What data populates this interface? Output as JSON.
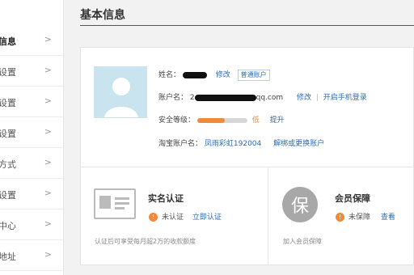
{
  "sidebar": {
    "items": [
      {
        "label": "",
        "active": false
      },
      {
        "label": "信息",
        "active": true
      },
      {
        "label": "设置",
        "active": false
      },
      {
        "label": "设置",
        "active": false
      },
      {
        "label": "设置",
        "active": false
      },
      {
        "label": "方式",
        "active": false
      },
      {
        "label": "设置",
        "active": false
      },
      {
        "label": "中心",
        "active": false
      },
      {
        "label": "地址",
        "active": false
      }
    ],
    "chevron_icon": "chevron-right-icon"
  },
  "page_title": "基本信息",
  "profile": {
    "name_label": "姓名：",
    "name_edit": "修改",
    "account_type": "普通账户",
    "account_label": "账户名：",
    "account_value_prefix": "2",
    "account_value_suffix": "qq.com",
    "account_edit": "修改",
    "phone_login": "开启手机登录",
    "security_label": "安全等级：",
    "security_level_text": "低",
    "security_level_fraction": 0.55,
    "upgrade": "提升",
    "taobao_label": "淘宝账户名：",
    "taobao_value": "凤雨彩虹192004",
    "unbind": "解绑或更换账户",
    "accent_color": "#2a6cb5",
    "warn_color": "#f08a3a"
  },
  "realname": {
    "title": "实名认证",
    "status": "未认证",
    "action": "立即认证",
    "desc": "认证后可享受每月超2万的收款额度",
    "icon": "id-card-icon"
  },
  "member": {
    "title": "会员保障",
    "icon_char": "保",
    "status": "未保障",
    "action": "查看",
    "desc": "加入会员保障"
  }
}
